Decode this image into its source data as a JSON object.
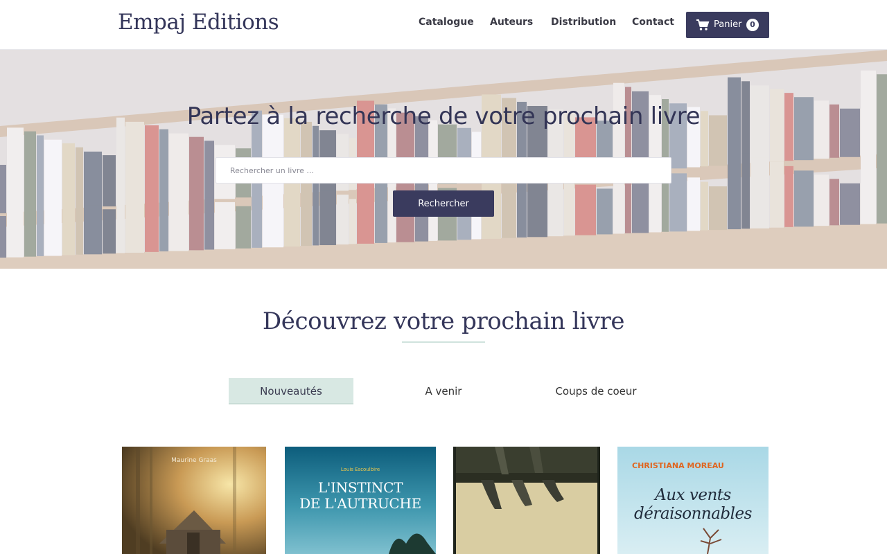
{
  "header": {
    "brand": "Empaj Editions",
    "nav": [
      "Catalogue",
      "Auteurs",
      "Distribution",
      "Contact"
    ],
    "cart": {
      "label": "Panier",
      "count": "0",
      "icon": "shopping-cart-icon"
    }
  },
  "hero": {
    "title": "Partez à la recherche de votre prochain livre",
    "search_placeholder": "Rechercher un livre ...",
    "search_value": "",
    "search_button": "Rechercher"
  },
  "section": {
    "title": "Découvrez votre prochain livre",
    "tabs": [
      "Nouveautés",
      "A venir",
      "Coups de coeur"
    ],
    "active_tab": "Nouveautés"
  },
  "books": [
    {
      "author": "Maurine Graas",
      "title": ""
    },
    {
      "author": "Louis Escoulbire",
      "title": "L'INSTINCT DE L'AUTRUCHE"
    },
    {
      "author": "",
      "title": ""
    },
    {
      "author": "CHRISTIANA MOREAU",
      "title": "Aux vents déraisonnables"
    }
  ],
  "colors": {
    "primary": "#3a3b5e",
    "accent_tab": "#d8e8e3",
    "text_dark": "#34365a"
  }
}
